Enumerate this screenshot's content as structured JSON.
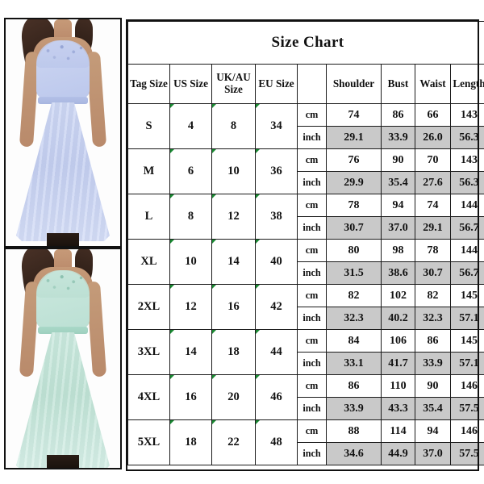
{
  "photos": [
    {
      "name": "lavender-blue-lace-chiffon-maxi-dress",
      "color_hex": "#c6d0ef",
      "color_label": "light periwinkle blue"
    },
    {
      "name": "mint-green-lace-chiffon-maxi-dress",
      "color_hex": "#c6e5da",
      "color_label": "mint green"
    }
  ],
  "table": {
    "title": "Size Chart",
    "headers": {
      "tag_size": "Tag Size",
      "us_size": "US Size",
      "uk_au_size": "UK/AU Size",
      "eu_size": "EU Size",
      "unit": "",
      "shoulder": "Shoulder",
      "bust": "Bust",
      "waist": "Waist",
      "length": "Length"
    },
    "unit_labels": {
      "cm": "cm",
      "inch": "inch"
    },
    "shaded_row_color": "#c9c9c9",
    "rows": [
      {
        "tag_size": "S",
        "us_size": "4",
        "uk_au_size": "8",
        "eu_size": "34",
        "cm": {
          "shoulder": "74",
          "bust": "86",
          "waist": "66",
          "length": "143"
        },
        "inch": {
          "shoulder": "29.1",
          "bust": "33.9",
          "waist": "26.0",
          "length": "56.3"
        }
      },
      {
        "tag_size": "M",
        "us_size": "6",
        "uk_au_size": "10",
        "eu_size": "36",
        "cm": {
          "shoulder": "76",
          "bust": "90",
          "waist": "70",
          "length": "143"
        },
        "inch": {
          "shoulder": "29.9",
          "bust": "35.4",
          "waist": "27.6",
          "length": "56.3"
        }
      },
      {
        "tag_size": "L",
        "us_size": "8",
        "uk_au_size": "12",
        "eu_size": "38",
        "cm": {
          "shoulder": "78",
          "bust": "94",
          "waist": "74",
          "length": "144"
        },
        "inch": {
          "shoulder": "30.7",
          "bust": "37.0",
          "waist": "29.1",
          "length": "56.7"
        }
      },
      {
        "tag_size": "XL",
        "us_size": "10",
        "uk_au_size": "14",
        "eu_size": "40",
        "cm": {
          "shoulder": "80",
          "bust": "98",
          "waist": "78",
          "length": "144"
        },
        "inch": {
          "shoulder": "31.5",
          "bust": "38.6",
          "waist": "30.7",
          "length": "56.7"
        }
      },
      {
        "tag_size": "2XL",
        "us_size": "12",
        "uk_au_size": "16",
        "eu_size": "42",
        "cm": {
          "shoulder": "82",
          "bust": "102",
          "waist": "82",
          "length": "145"
        },
        "inch": {
          "shoulder": "32.3",
          "bust": "40.2",
          "waist": "32.3",
          "length": "57.1"
        }
      },
      {
        "tag_size": "3XL",
        "us_size": "14",
        "uk_au_size": "18",
        "eu_size": "44",
        "cm": {
          "shoulder": "84",
          "bust": "106",
          "waist": "86",
          "length": "145"
        },
        "inch": {
          "shoulder": "33.1",
          "bust": "41.7",
          "waist": "33.9",
          "length": "57.1"
        }
      },
      {
        "tag_size": "4XL",
        "us_size": "16",
        "uk_au_size": "20",
        "eu_size": "46",
        "cm": {
          "shoulder": "86",
          "bust": "110",
          "waist": "90",
          "length": "146"
        },
        "inch": {
          "shoulder": "33.9",
          "bust": "43.3",
          "waist": "35.4",
          "length": "57.5"
        }
      },
      {
        "tag_size": "5XL",
        "us_size": "18",
        "uk_au_size": "22",
        "eu_size": "48",
        "cm": {
          "shoulder": "88",
          "bust": "114",
          "waist": "94",
          "length": "146"
        },
        "inch": {
          "shoulder": "34.6",
          "bust": "44.9",
          "waist": "37.0",
          "length": "57.5"
        }
      }
    ]
  }
}
